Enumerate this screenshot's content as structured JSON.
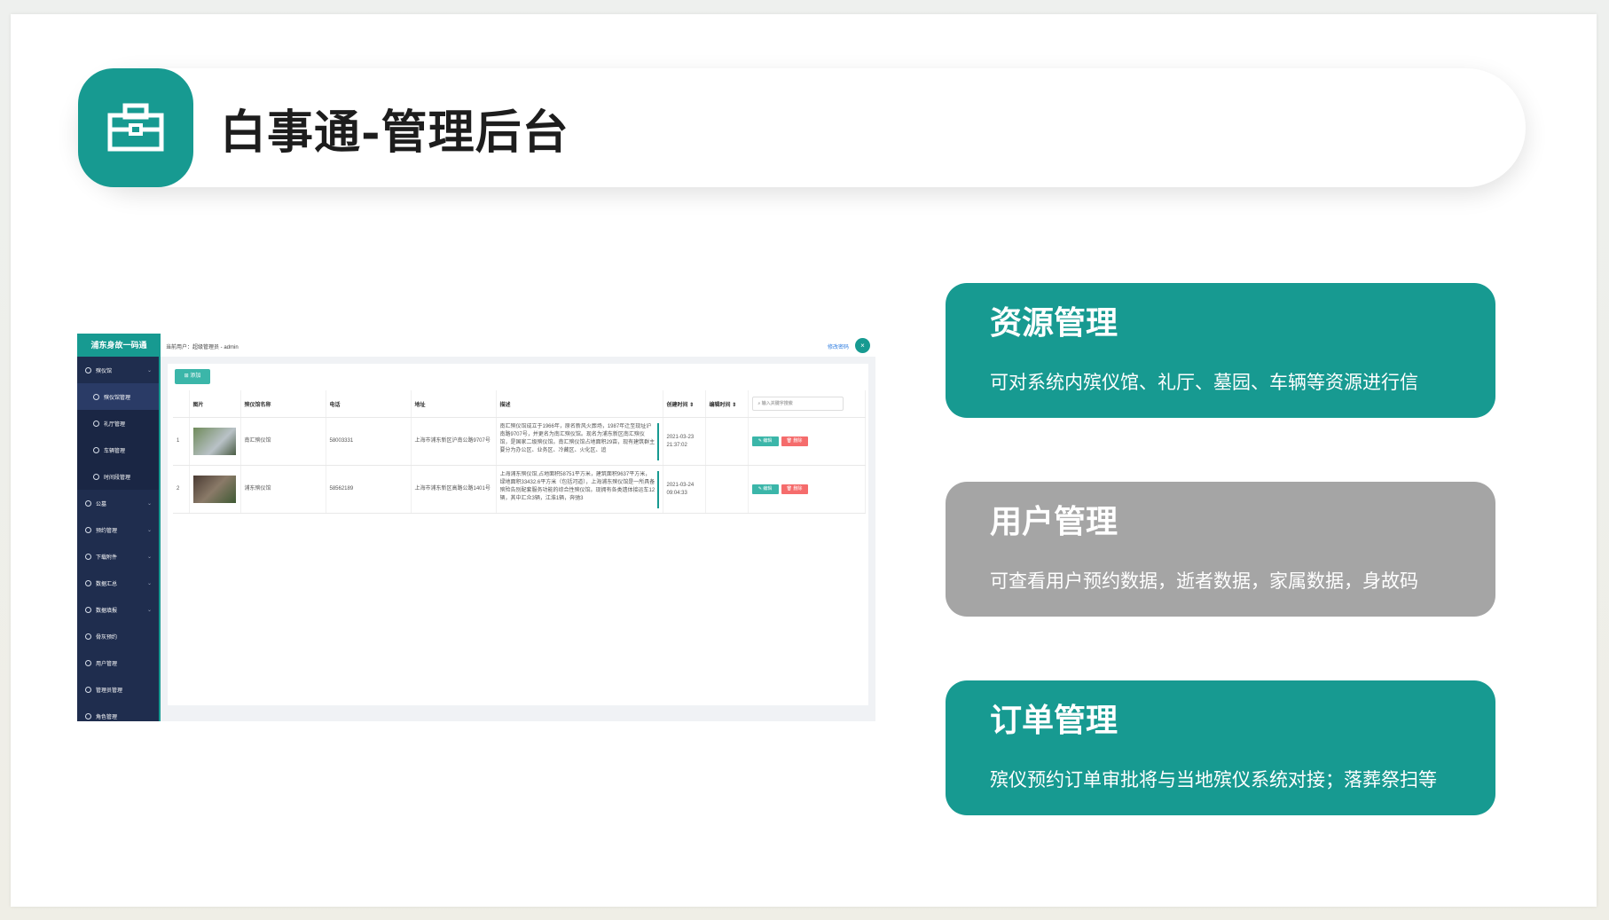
{
  "header": {
    "title": "白事通-管理后台",
    "icon": "briefcase-icon"
  },
  "colors": {
    "accent": "#179a91",
    "gray_card": "#a5a5a5",
    "sidebar": "#1f2d4e"
  },
  "screenshot": {
    "logo": "浦东身故一码通",
    "current_user": "当前用户：超级管理员 - admin",
    "change_password": "修改密码",
    "avatar_text": "×",
    "menu": [
      {
        "label": "殡仪馆",
        "sub": false
      },
      {
        "label": "殡仪馆管理",
        "sub": true,
        "active": true
      },
      {
        "label": "礼厅管理",
        "sub": true
      },
      {
        "label": "车辆管理",
        "sub": true
      },
      {
        "label": "时间段管理",
        "sub": true
      },
      {
        "label": "公墓",
        "sub": false
      },
      {
        "label": "预约管理",
        "sub": false
      },
      {
        "label": "下载附件",
        "sub": false
      },
      {
        "label": "数据汇总",
        "sub": false
      },
      {
        "label": "数据填报",
        "sub": false
      },
      {
        "label": "骨灰预约",
        "sub": false
      },
      {
        "label": "用户管理",
        "sub": false
      },
      {
        "label": "管理员管理",
        "sub": false
      },
      {
        "label": "角色管理",
        "sub": false
      }
    ],
    "add_button": "添加",
    "columns": [
      "",
      "图片",
      "殡仪馆名称",
      "电话",
      "地址",
      "描述",
      "创建时间",
      "编辑时间"
    ],
    "search_placeholder": "输入关键字搜索",
    "edit_label": "编辑",
    "delete_label": "删除",
    "rows": [
      {
        "index": "1",
        "name": "南汇殡仪馆",
        "phone": "58003331",
        "address": "上海市浦东新区沪南公路9707号",
        "description": "南汇殡仪馆成立于1966年，原名新风火葬场，1987年迁至现址沪南路9707号，并更名为南汇殡仪馆。现名为浦东新区南汇殡仪馆，是国家二级殡仪馆。南汇殡仪馆占地面积29亩，现有建筑群主要分为办公区、业务区、冷藏区、火化区、追",
        "created": "2021-03-23 21:37:02",
        "edited": ""
      },
      {
        "index": "2",
        "name": "浦东殡仪馆",
        "phone": "58562189",
        "address": "上海市浦东新区高路公路1401号",
        "description": "上海浦东殡仪馆,占地面积58751平方米，建筑面积9637平方米，绿地面积33432.6平方米（包括河道），上海浦东殡仪馆是一所具备殡殓告别配套服务功能的综合性殡仪馆。现拥有各类遗体接运车12辆，其中汇众3辆，江淮1辆，奔驰3",
        "created": "2021-03-24 09:04:33",
        "edited": ""
      }
    ]
  },
  "cards": [
    {
      "title": "资源管理",
      "text": "可对系统内殡仪馆、礼厅、墓园、车辆等资源进行信",
      "style": "teal"
    },
    {
      "title": "用户管理",
      "text": "可查看用户预约数据，逝者数据，家属数据，身故码",
      "style": "gray"
    },
    {
      "title": "订单管理",
      "text": "殡仪预约订单审批将与当地殡仪系统对接；落葬祭扫等",
      "style": "teal"
    }
  ]
}
